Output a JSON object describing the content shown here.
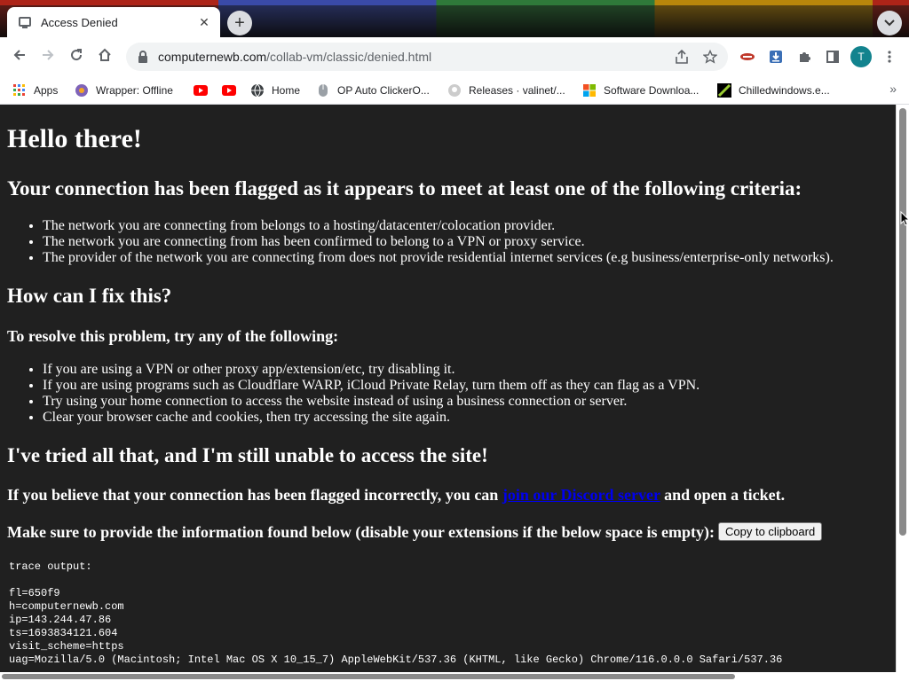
{
  "browser": {
    "tab": {
      "title": "Access Denied",
      "close_glyph": "✕"
    },
    "new_tab_glyph": "+",
    "url": {
      "domain": "computernewb.com",
      "path": "/collab-vm/classic/denied.html"
    },
    "profile_initial": "T",
    "bookmarks": [
      {
        "label": "Apps",
        "icon": "apps-grid-icon"
      },
      {
        "label": "Wrapper: Offline",
        "icon": "wrapper-icon"
      },
      {
        "label": "",
        "icon": "youtube-icon"
      },
      {
        "label": "",
        "icon": "youtube-icon"
      },
      {
        "label": "Home",
        "icon": "globe-icon"
      },
      {
        "label": "OP Auto ClickerO...",
        "icon": "autoclicker-icon"
      },
      {
        "label": "Releases · valinet/...",
        "icon": "github-icon"
      },
      {
        "label": "Software Downloa...",
        "icon": "windows-icon"
      },
      {
        "label": "Chilledwindows.e...",
        "icon": "chilledwindows-icon"
      }
    ],
    "overflow_glyph": "»"
  },
  "page": {
    "h1": "Hello there!",
    "criteria_heading": "Your connection has been flagged as it appears to meet at least one of the following criteria:",
    "criteria": [
      "The network you are connecting from belongs to a hosting/datacenter/colocation provider.",
      "The network you are connecting from has been confirmed to belong to a VPN or proxy service.",
      "The provider of the network you are connecting from does not provide residential internet services (e.g business/enterprise-only networks)."
    ],
    "fix_heading": "How can I fix this?",
    "resolve_heading": "To resolve this problem, try any of the following:",
    "steps": [
      "If you are using a VPN or other proxy app/extension/etc, try disabling it.",
      "If you are using programs such as Cloudflare WARP, iCloud Private Relay, turn them off as they can flag as a VPN.",
      "Try using your home connection to access the website instead of using a business connection or server.",
      "Clear your browser cache and cookies, then try accessing the site again."
    ],
    "tried_heading": "I've tried all that, and I'm still unable to access the site!",
    "ticket": {
      "before": "If you believe that your connection has been flagged incorrectly, you can ",
      "link": "join our Discord server",
      "after": " and open a ticket."
    },
    "provide_text": "Make sure to provide the information found below (disable your extensions if the below space is empty):",
    "copy_button": "Copy to clipboard",
    "trace": "trace output:\n\nfl=650f9\nh=computernewb.com\nip=143.244.47.86\nts=1693834121.604\nvisit_scheme=https\nuag=Mozilla/5.0 (Macintosh; Intel Mac OS X 10_15_7) AppleWebKit/537.36 (KHTML, like Gecko) Chrome/116.0.0.0 Safari/537.36"
  }
}
